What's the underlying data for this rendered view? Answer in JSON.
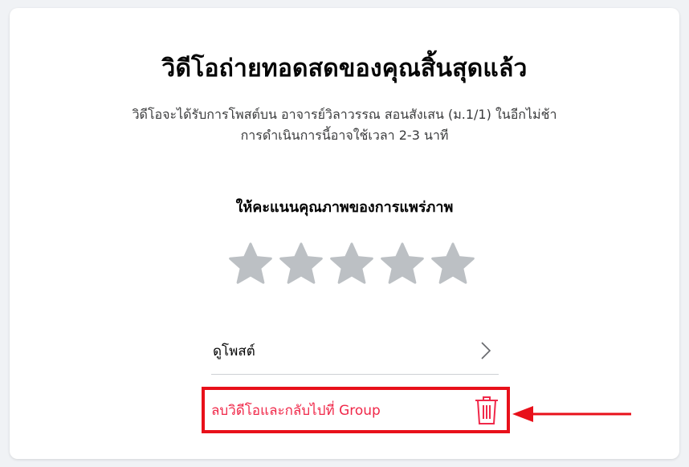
{
  "dialog": {
    "title": "วิดีโอถ่ายทอดสดของคุณสิ้นสุดแล้ว",
    "subtitle_line1": "วิดีโอจะได้รับการโพสต์บน อาจารย์วิลาวรรณ สอนสังเสน (ม.1/1) ในอีกไม่ช้า",
    "subtitle_line2": "การดำเนินการนี้อาจใช้เวลา 2-3 นาที",
    "rating": {
      "label": "ให้คะแนนคุณภาพของการแพร่ภาพ",
      "max": 5,
      "value": 0,
      "star_color": "#bcc0c4"
    },
    "view_post_label": "ดูโพสต์",
    "delete_label": "ลบวิดีโอและกลับไปที่ Group",
    "delete_color": "#f02849"
  },
  "annotation": {
    "highlight_color": "#e8101a",
    "icons": [
      "chevron-right-icon",
      "trash-icon",
      "arrow-left-icon"
    ]
  }
}
